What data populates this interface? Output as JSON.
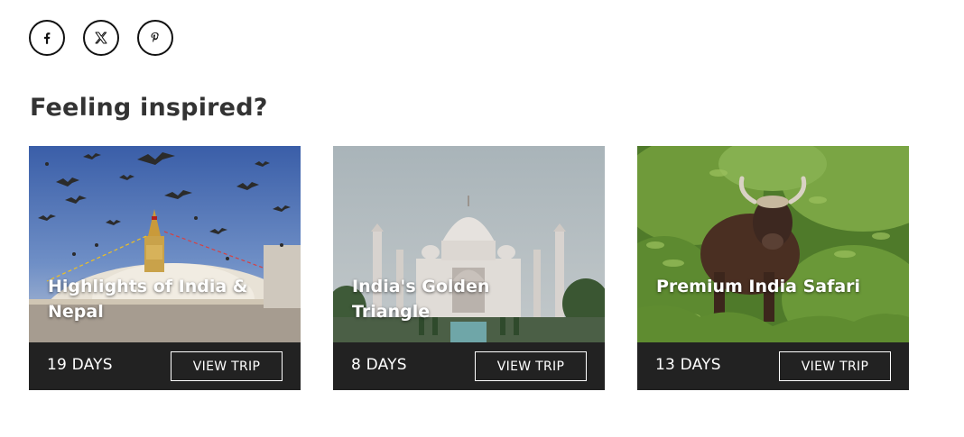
{
  "share": {
    "buttons": [
      {
        "icon": "facebook-icon"
      },
      {
        "icon": "x-icon"
      },
      {
        "icon": "pinterest-icon"
      }
    ]
  },
  "heading": "Feeling inspired?",
  "trips": [
    {
      "title": "Highlights of India & Nepal",
      "days": "19 DAYS",
      "cta": "VIEW TRIP",
      "image": "stupa-with-pigeons"
    },
    {
      "title": "India's Golden Triangle",
      "days": "8 DAYS",
      "cta": "VIEW TRIP",
      "image": "taj-mahal"
    },
    {
      "title": "Premium India Safari",
      "days": "13 DAYS",
      "cta": "VIEW TRIP",
      "image": "gaur-in-forest"
    }
  ],
  "colors": {
    "card_footer": "#222222",
    "heading": "#333333",
    "text_on_dark": "#ffffff"
  }
}
